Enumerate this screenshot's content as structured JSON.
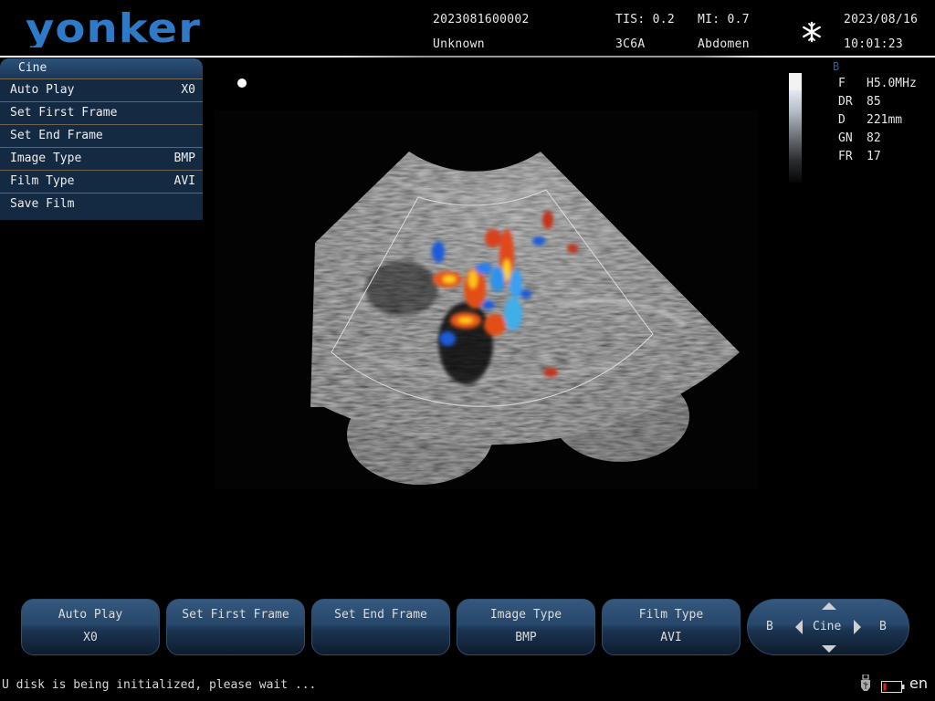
{
  "header": {
    "brand": "YONKER",
    "brand_color": "#2f7ac8",
    "patient_id": "2023081600002",
    "patient_name": "Unknown",
    "tis": "TIS: 0.2",
    "mi": "MI: 0.7",
    "probe": "3C6A",
    "preset": "Abdomen",
    "freeze_icon": "snowflake-icon",
    "date": "2023/08/16",
    "time": "10:01:23"
  },
  "cine_menu": {
    "title": "Cine",
    "items": [
      {
        "label": "Auto Play",
        "value": "X0"
      },
      {
        "label": "Set First Frame",
        "value": ""
      },
      {
        "label": "Set End Frame",
        "value": ""
      },
      {
        "label": "Image Type",
        "value": "BMP"
      },
      {
        "label": "Film Type",
        "value": "AVI"
      },
      {
        "label": "Save Film",
        "value": ""
      }
    ]
  },
  "parameters": {
    "mode": "B",
    "rows": [
      {
        "key": "F",
        "value": "H5.0MHz"
      },
      {
        "key": "DR",
        "value": "85"
      },
      {
        "key": "D",
        "value": "221mm"
      },
      {
        "key": "GN",
        "value": "82"
      },
      {
        "key": "FR",
        "value": "17"
      }
    ]
  },
  "soft_buttons": [
    {
      "label": "Auto Play",
      "value": "X0"
    },
    {
      "label": "Set First Frame",
      "value": ""
    },
    {
      "label": "Set End Frame",
      "value": ""
    },
    {
      "label": "Image Type",
      "value": "BMP"
    },
    {
      "label": "Film Type",
      "value": "AVI"
    }
  ],
  "nav_control": {
    "left_label": "B",
    "center_label": "Cine",
    "right_label": "B"
  },
  "status_bar": {
    "message": "U disk is being initialized, please wait ...",
    "usb_icon": "usb-icon",
    "battery_icon": "battery-low-icon",
    "battery_color": "#e02020",
    "language": "en"
  }
}
